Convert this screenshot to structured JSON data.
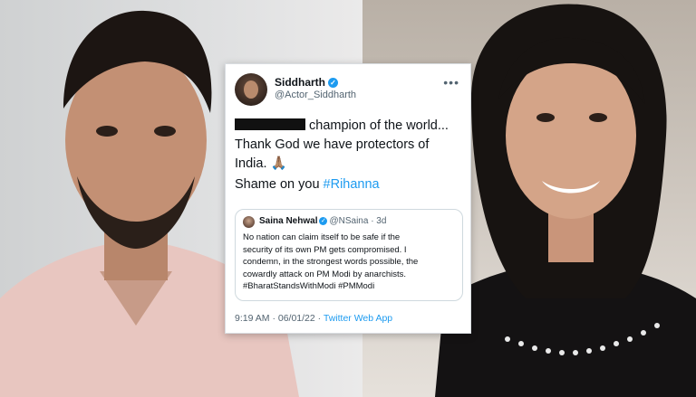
{
  "tweet": {
    "author_name": "Siddharth",
    "author_handle": "@Actor_Siddharth",
    "verified_mark": "✓",
    "more_glyph": "•••",
    "line1_after_redaction": "champion of the world...",
    "line2": "Thank God we have protectors of",
    "line3": "India. 🙏🏽",
    "shame_text": "Shame on you ",
    "shame_hashtag": "#Rihanna",
    "timestamp": "9:19 AM · 06/01/22 · ",
    "source_app": "Twitter Web App"
  },
  "quoted_tweet": {
    "author_name": "Saina Nehwal",
    "verified_mark": "✓",
    "handle_and_age": "@NSaina · 3d",
    "body_lines": [
      "No nation can claim itself to be safe if the",
      "security of its own PM gets compromised. I",
      "condemn, in the strongest words possible, the",
      "cowardly attack on PM Modi by anarchists.",
      "#BharatStandsWithModi #PMModi"
    ]
  },
  "colors": {
    "accent": "#1d9bf0",
    "text": "#0f1419",
    "muted": "#536471"
  }
}
